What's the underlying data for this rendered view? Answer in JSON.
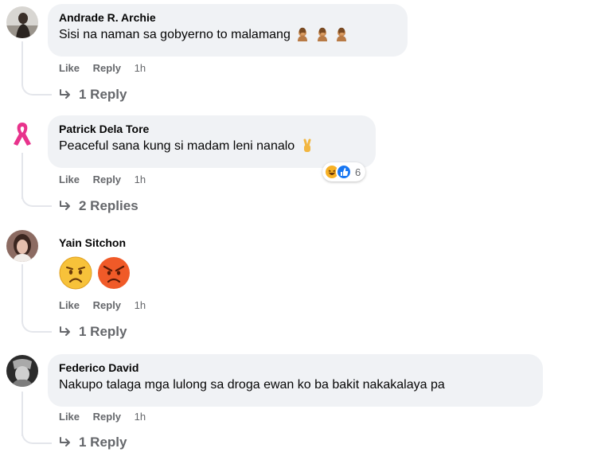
{
  "comments": [
    {
      "author": "Andrade R. Archie",
      "text": "Sisi na naman sa gobyerno to malamang",
      "trailing_emoji": [
        "person-facepalming-icon",
        "person-facepalming-icon",
        "person-facepalming-icon"
      ],
      "like_label": "Like",
      "reply_label": "Reply",
      "time": "1h",
      "replies_label": "1 Reply"
    },
    {
      "author": "Patrick Dela Tore",
      "text": "Peaceful sana kung si madam leni nanalo",
      "trailing_emoji": [
        "victory-hand-icon"
      ],
      "like_label": "Like",
      "reply_label": "Reply",
      "time": "1h",
      "replies_label": "2 Replies",
      "reactions": {
        "types": [
          "haha-icon",
          "like-icon"
        ],
        "count": "6"
      }
    },
    {
      "author": "Yain Sitchon",
      "text": "",
      "big_emoji": [
        "frowning-face-icon",
        "angry-face-icon"
      ],
      "like_label": "Like",
      "reply_label": "Reply",
      "time": "1h",
      "replies_label": "1 Reply"
    },
    {
      "author": "Federico David",
      "text": "Nakupo talaga mga lulong sa droga ewan ko ba bakit nakakalaya pa",
      "like_label": "Like",
      "reply_label": "Reply",
      "time": "1h",
      "replies_label": "1 Reply"
    }
  ],
  "colors": {
    "bubble": "#f0f2f5",
    "meta_text": "#65676b",
    "like_blue": "#1877f2",
    "haha_yellow": "#f7b125",
    "ribbon_pink": "#e8338c"
  }
}
